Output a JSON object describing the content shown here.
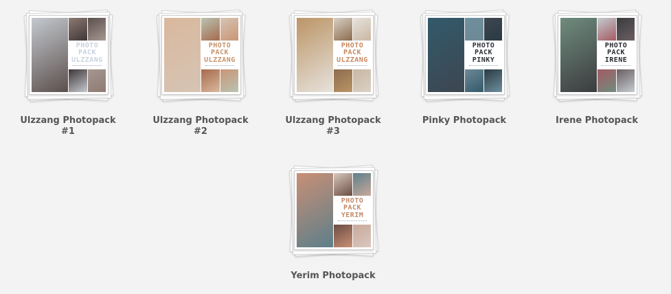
{
  "items": [
    {
      "title_line1": "Ulzzang Photopack",
      "title_line2": "#1",
      "cover_label": [
        "PHOTO",
        "PACK",
        "ULZZANG"
      ],
      "label_color": "#c9d3df",
      "tones": [
        "#c4c9cf",
        "#8d7a72",
        "#5b4f4c",
        "#3f3637",
        "#a69791"
      ]
    },
    {
      "title_line1": "Ulzzang Photopack",
      "title_line2": "#2",
      "cover_label": [
        "PHOTO",
        "PACK",
        "ULZZANG"
      ],
      "label_color": "#c7946a",
      "tones": [
        "#d9b89d",
        "#b9c3b2",
        "#d6c4b4",
        "#a56a4d",
        "#c99575"
      ]
    },
    {
      "title_line1": "Ulzzang Photopack",
      "title_line2": "#3",
      "cover_label": [
        "PHOTO",
        "PACK",
        "ULZZANG"
      ],
      "label_color": "#c9895f",
      "tones": [
        "#bb9566",
        "#d8d1c6",
        "#e6e2dc",
        "#8c6b4e",
        "#c9b7a2"
      ]
    },
    {
      "title_line1": "Pinky Photopack",
      "title_line2": "",
      "cover_label": [
        "PHOTO",
        "PACK",
        "PINKY"
      ],
      "label_color": "#2c2f35",
      "tones": [
        "#325a6b",
        "#6e8f9c",
        "#3d4650",
        "#6e8896",
        "#2a3a44"
      ]
    },
    {
      "title_line1": "Irene Photopack",
      "title_line2": "",
      "cover_label": [
        "PHOTO",
        "PACK",
        "IRENE"
      ],
      "label_color": "#272a2f",
      "tones": [
        "#6f8c7e",
        "#c4ccd0",
        "#3b3b3e",
        "#a45a63",
        "#6a5e62"
      ]
    },
    {
      "title_line1": "Yerim Photopack",
      "title_line2": "",
      "cover_label": [
        "PHOTO",
        "PACK",
        "YERIM"
      ],
      "label_color": "#c38a6a",
      "tones": [
        "#c98f76",
        "#d8c7bd",
        "#5c7f8a",
        "#6b4d43",
        "#c9a99b"
      ]
    }
  ]
}
